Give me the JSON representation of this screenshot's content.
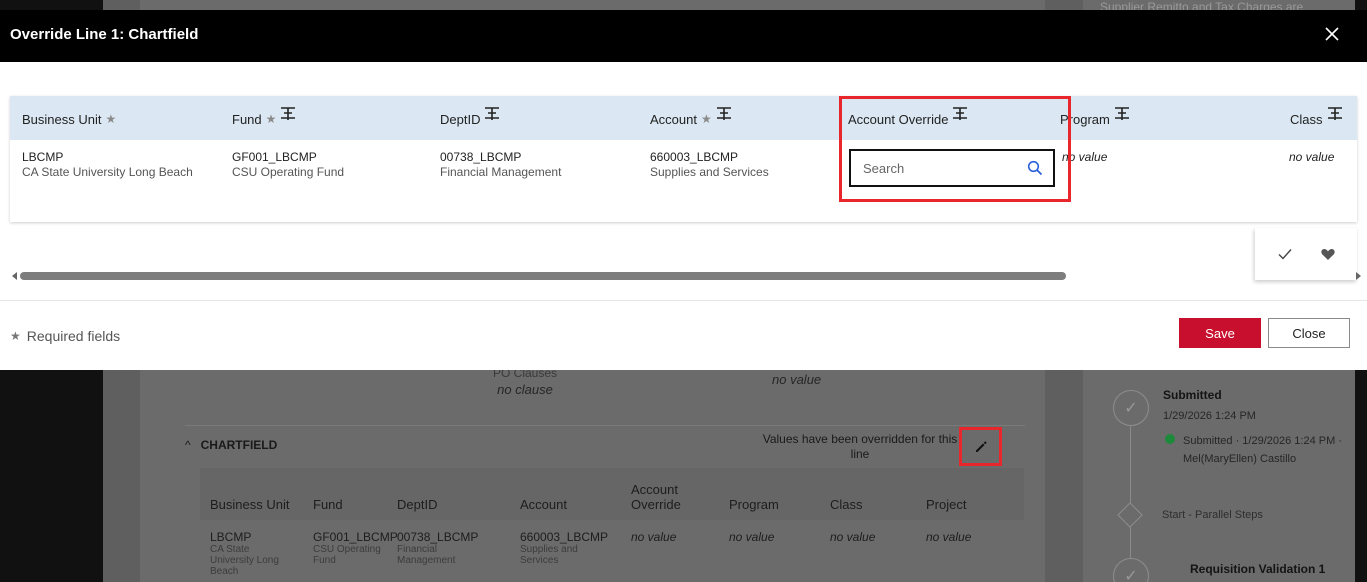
{
  "background": {
    "top_text": "Supplier Remitto and Tax Charges are",
    "po_clauses_label": "PO Clauses",
    "po_clauses_value": "no clause",
    "no_value_top": "no value",
    "chartfield": {
      "title": "CHARTFIELD",
      "note": "Values have been overridden for this line",
      "columns": [
        "Business Unit",
        "Fund",
        "DeptID",
        "Account",
        "Account Override",
        "Program",
        "Class",
        "Project"
      ],
      "row": {
        "business_unit": "LBCMP",
        "business_unit_desc": "CA State University Long Beach",
        "fund": "GF001_LBCMP",
        "fund_desc": "CSU Operating Fund",
        "deptid": "00738_LBCMP",
        "deptid_desc": "Financial Management",
        "account": "660003_LBCMP",
        "account_desc": "Supplies and Services",
        "account_override": "no value",
        "program": "no value",
        "class": "no value",
        "project": "no value"
      }
    },
    "timeline": {
      "submitted_title": "Submitted",
      "submitted_date": "1/29/2026 1:24 PM",
      "submitted_detail": "Submitted · 1/29/2026 1:24 PM · Mel(MaryEllen) Castillo",
      "start_parallel": "Start - Parallel Steps",
      "req_validation": "Requisition Validation 1",
      "status_color": "#1c8a3a"
    }
  },
  "modal": {
    "title": "Override Line 1: Chartfield",
    "headers": {
      "business_unit": "Business Unit",
      "fund": "Fund",
      "deptid": "DeptID",
      "account": "Account",
      "account_override": "Account Override",
      "program": "Program",
      "class": "Class"
    },
    "row": {
      "business_unit": "LBCMP",
      "business_unit_desc": "CA State University Long Beach",
      "fund": "GF001_LBCMP",
      "fund_desc": "CSU Operating Fund",
      "deptid": "00738_LBCMP",
      "deptid_desc": "Financial Management",
      "account": "660003_LBCMP",
      "account_desc": "Supplies and Services",
      "program": "no value",
      "class": "no value"
    },
    "search": {
      "placeholder": "Search",
      "value": ""
    },
    "required_fields": "Required fields",
    "save_label": "Save",
    "close_label": "Close",
    "accent_color": "#c8102e",
    "header_bg": "#dbe8f3",
    "highlight_color": "#e8262b"
  }
}
